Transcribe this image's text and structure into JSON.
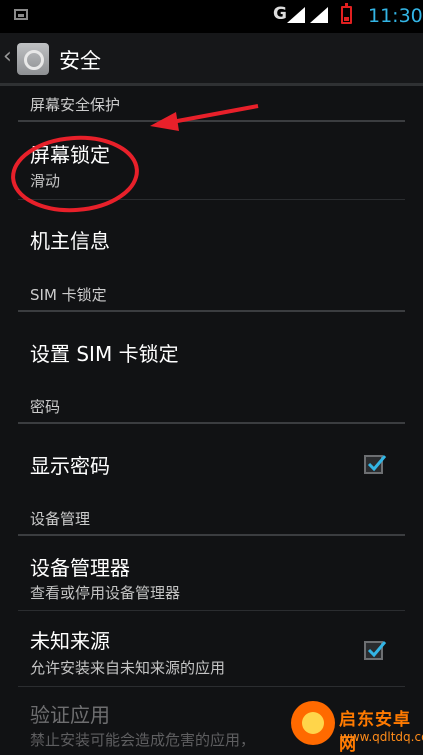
{
  "status_bar": {
    "network_label": "G",
    "time": "11:30",
    "colors": {
      "time": "#33b5e5",
      "battery": "#e02020"
    }
  },
  "action_bar": {
    "title": "安全",
    "icon": "settings-gear-icon"
  },
  "sections": [
    {
      "header": "屏幕安全保护",
      "items": [
        {
          "title": "屏幕锁定",
          "summary": "滑动"
        }
      ]
    },
    {
      "items": [
        {
          "title": "机主信息"
        }
      ]
    },
    {
      "header": "SIM 卡锁定",
      "items": [
        {
          "title": "设置 SIM 卡锁定"
        }
      ]
    },
    {
      "header": "密码",
      "items": [
        {
          "title": "显示密码",
          "checked": true
        }
      ]
    },
    {
      "header": "设备管理",
      "items": [
        {
          "title": "设备管理器",
          "summary": "查看或停用设备管理器"
        },
        {
          "title": "未知来源",
          "summary": "允许安装来自未知来源的应用",
          "checked": true
        },
        {
          "title": "验证应用",
          "summary": "禁止安装可能会造成危害的应用，",
          "disabled": true
        }
      ]
    }
  ],
  "annotation": {
    "color": "#e8202a"
  },
  "watermark": {
    "brand": "启东安卓网",
    "url": "www.qdltdq.com"
  },
  "accent_color": "#33b5e5"
}
